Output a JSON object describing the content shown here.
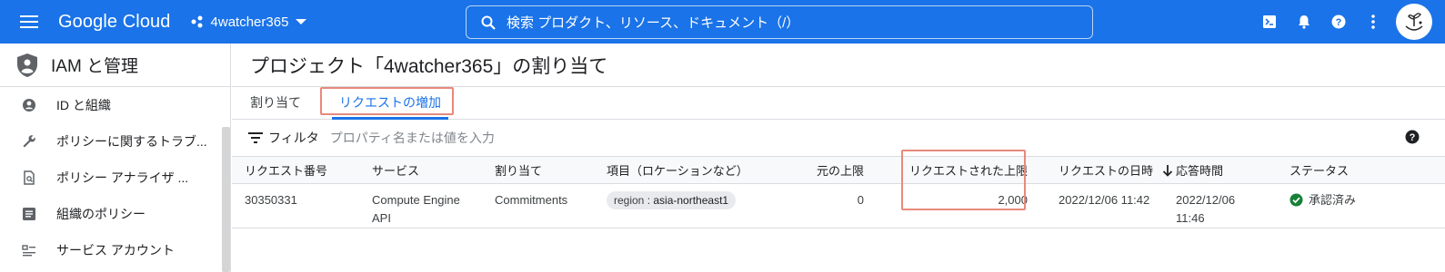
{
  "topbar": {
    "brand": "Google Cloud",
    "project": "4watcher365",
    "search_placeholder": "検索 プロダクト、リソース、ドキュメント（/）"
  },
  "sidebar": {
    "title": "IAM と管理",
    "items": [
      {
        "label": "ID と組織",
        "icon": "person-circle-icon"
      },
      {
        "label": "ポリシーに関するトラブ...",
        "icon": "wrench-icon"
      },
      {
        "label": "ポリシー アナライザ ...",
        "icon": "document-search-icon"
      },
      {
        "label": "組織のポリシー",
        "icon": "list-icon"
      },
      {
        "label": "サービス アカウント",
        "icon": "service-account-icon"
      }
    ]
  },
  "main": {
    "title": "プロジェクト「4watcher365」の割り当て",
    "tabs": [
      {
        "label": "割り当て"
      },
      {
        "label": "リクエストの増加"
      }
    ],
    "filter": {
      "label": "フィルタ",
      "placeholder": "プロパティ名または値を入力"
    },
    "table": {
      "headers": [
        "リクエスト番号",
        "サービス",
        "割り当て",
        "項目（ロケーションなど）",
        "元の上限",
        "リクエストされた上限",
        "リクエストの日時",
        "応答時間",
        "ステータス"
      ],
      "rows": [
        {
          "request_id": "30350331",
          "service_line1": "Compute Engine",
          "service_line2": "API",
          "quota": "Commitments",
          "chip_key": "region : ",
          "chip_value": "asia-northeast1",
          "original_limit": "0",
          "requested_limit": "2,000",
          "requested_at": "2022/12/06 11:42",
          "response_line1": "2022/12/06",
          "response_line2": "11:46",
          "status": "承認済み"
        }
      ]
    }
  },
  "colors": {
    "topbar": "#1a73e8",
    "highlight": "#e8897c",
    "success": "#188038"
  }
}
